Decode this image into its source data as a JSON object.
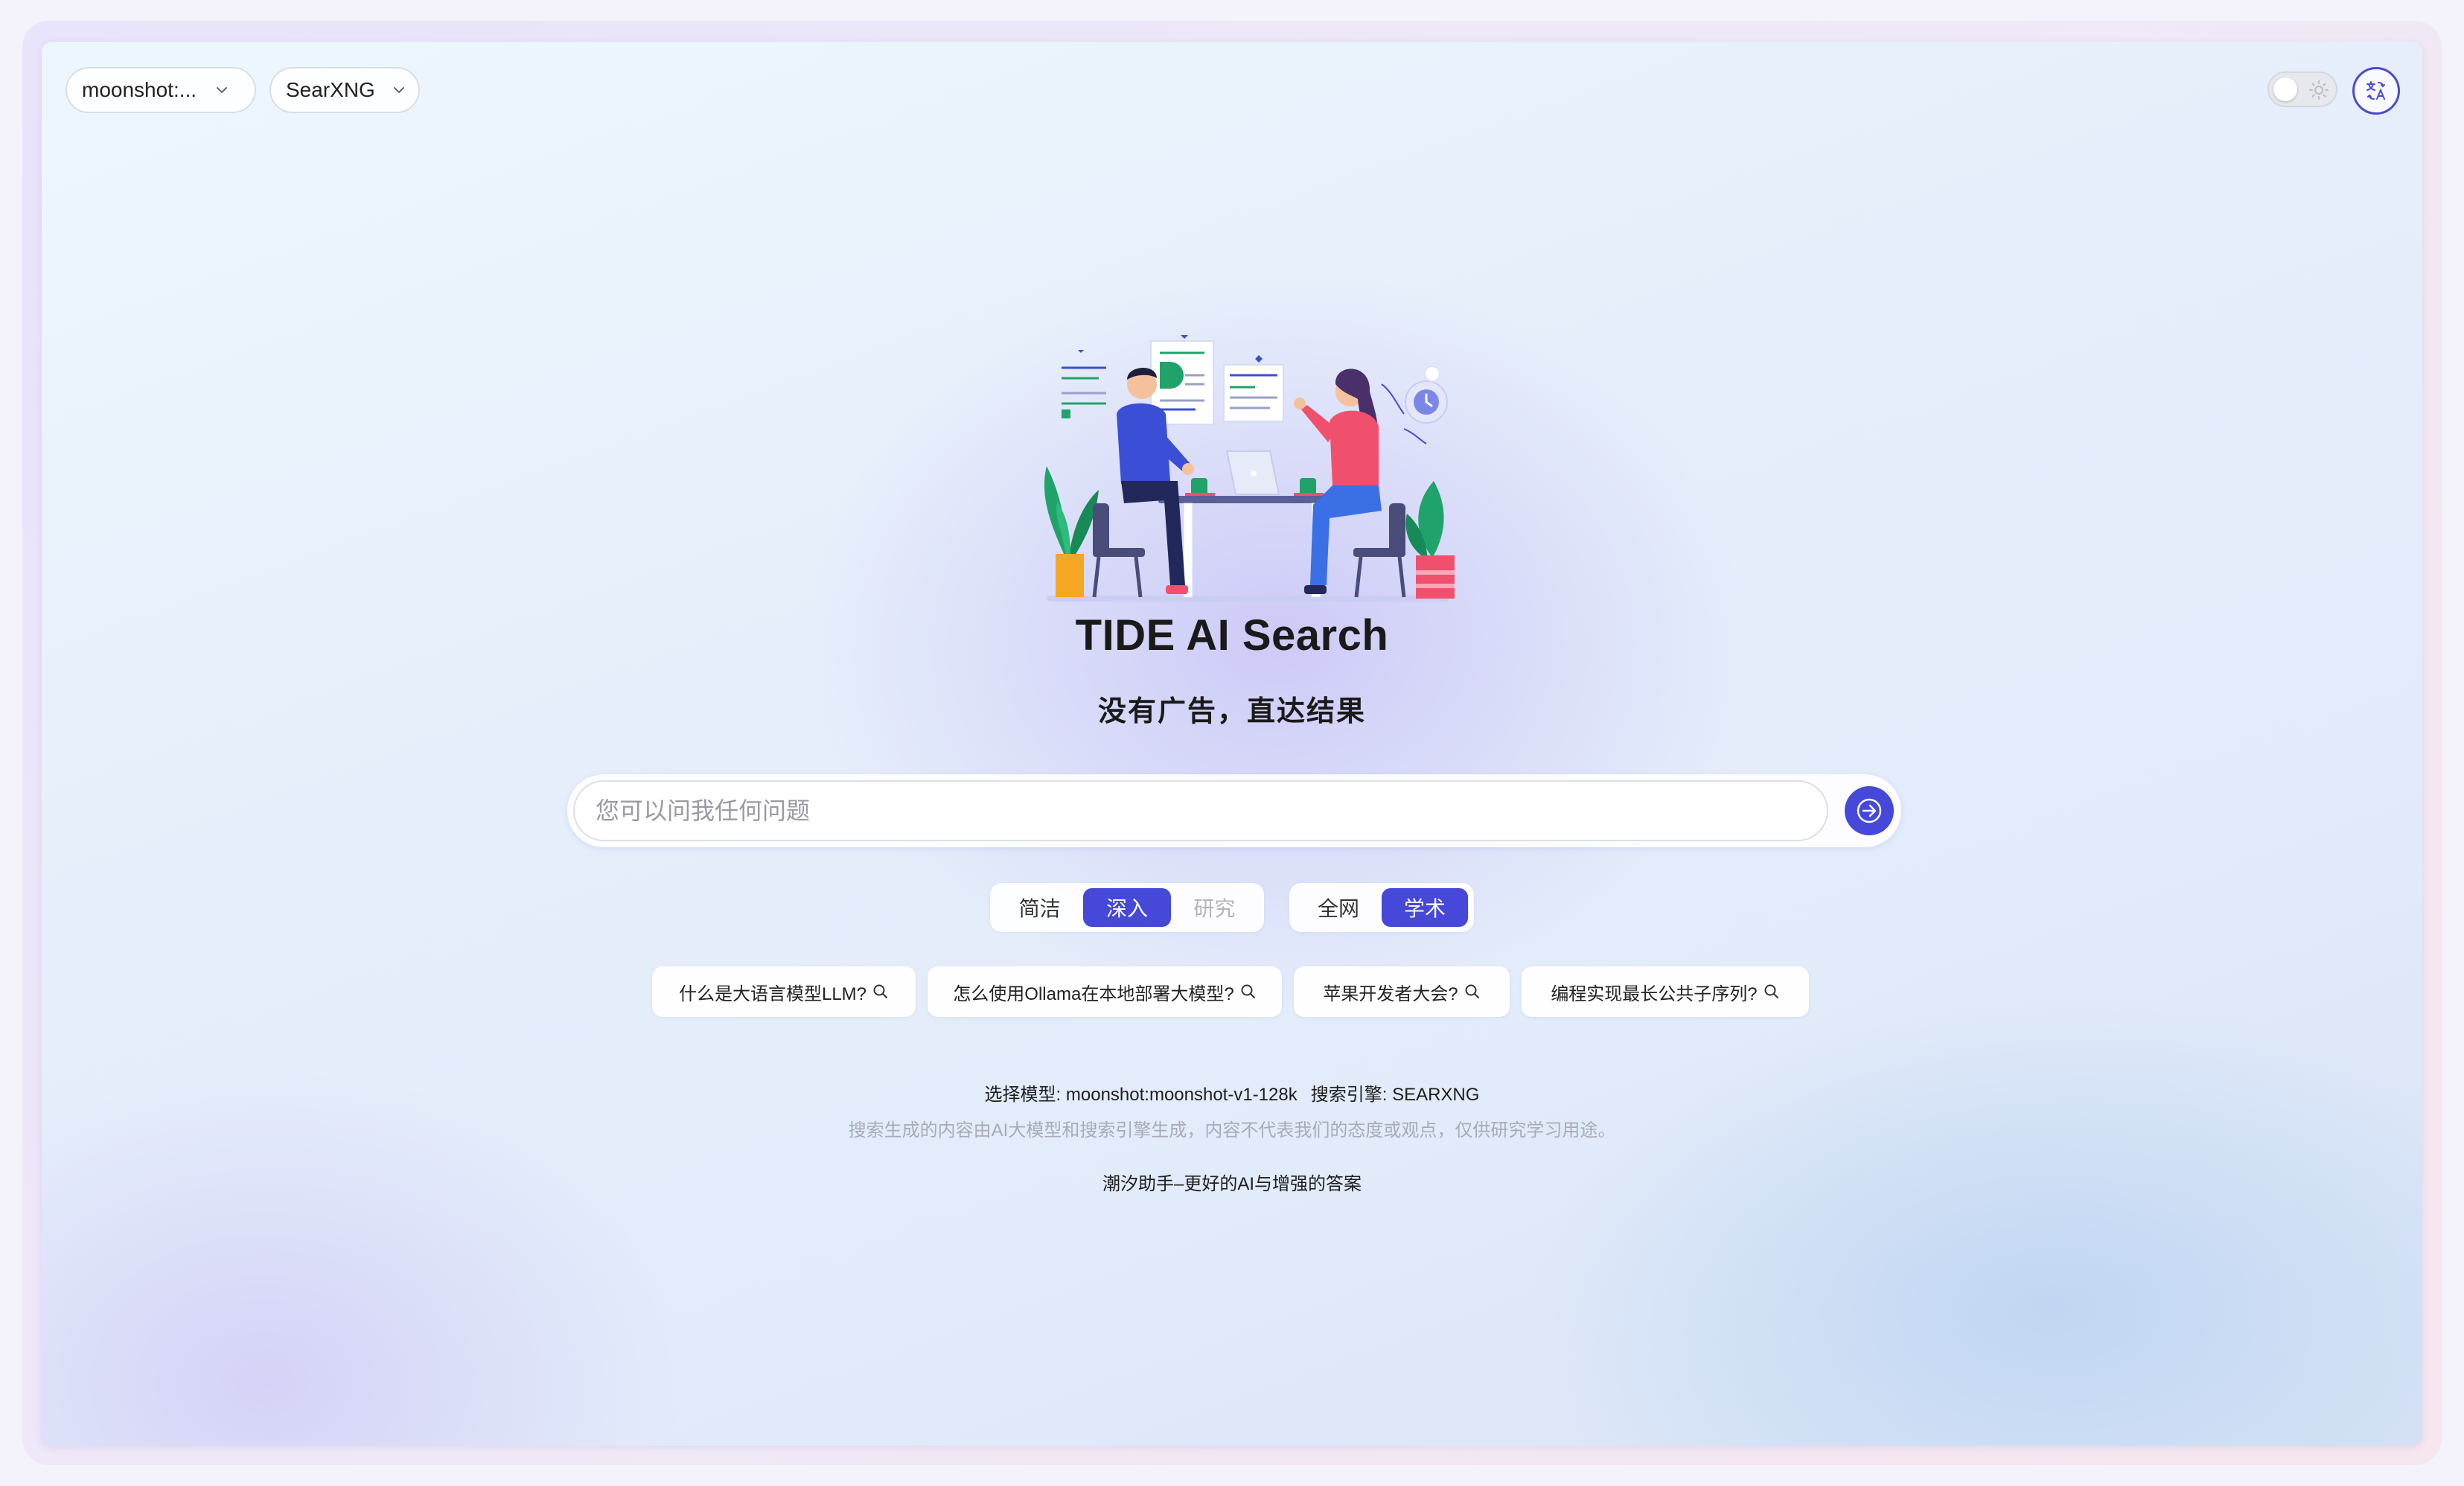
{
  "header": {
    "model_select": {
      "value": "moonshot:..."
    },
    "engine_select": {
      "value": "SearXNG"
    },
    "theme_toggle": {
      "state": "light",
      "icon": "sun-icon"
    },
    "language_button": {
      "icon": "translate-icon"
    }
  },
  "hero": {
    "title": "TIDE AI Search",
    "subtitle": "没有广告，直达结果"
  },
  "search": {
    "placeholder": "您可以问我任何问题",
    "value": ""
  },
  "mode": {
    "options": [
      "简洁",
      "深入",
      "研究"
    ],
    "selected": "深入",
    "disabled": [
      "研究"
    ]
  },
  "scope": {
    "options": [
      "全网",
      "学术"
    ],
    "selected": "学术"
  },
  "suggestions": [
    "什么是大语言模型LLM?",
    "怎么使用Ollama在本地部署大模型?",
    "苹果开发者大会?",
    "编程实现最长公共子序列?"
  ],
  "footer": {
    "model_info": "选择模型: moonshot:moonshot-v1-128k",
    "engine_info": "搜索引擎: SEARXNG",
    "disclaimer": "搜索生成的内容由AI大模型和搜索引擎生成，内容不代表我们的态度或观点，仅供研究学习用途。",
    "slogan": "潮汐助手–更好的AI与增强的答案"
  },
  "colors": {
    "accent": "#4548d8",
    "person_left_shirt": "#3b4fd6",
    "person_right_shirt": "#f0506e",
    "plant": "#1fa36a"
  }
}
